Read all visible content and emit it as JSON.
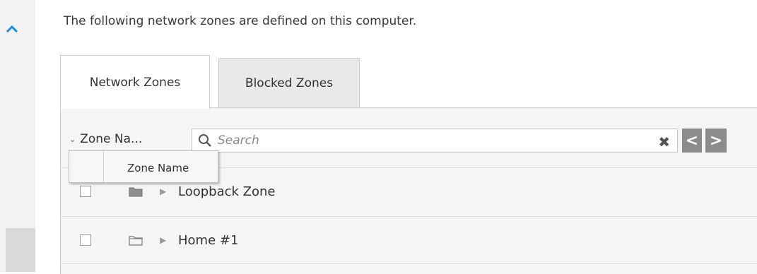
{
  "intro_text": "The following network zones are defined on this computer.",
  "tabs": [
    {
      "label": "Network Zones",
      "active": true
    },
    {
      "label": "Blocked Zones",
      "active": false
    }
  ],
  "toolbar": {
    "column_select_label": "Zone Na...",
    "search_placeholder": "Search",
    "clear_icon": "close-icon",
    "prev_label": "<",
    "next_label": ">"
  },
  "column_menu": {
    "items": [
      "Zone Name"
    ]
  },
  "rows": [
    {
      "label": "Loopback Zone",
      "checked": false
    },
    {
      "label": "Home #1",
      "checked": false
    }
  ],
  "colors": {
    "accent": "#1a8fd1",
    "nav_button": "#8c8c8c",
    "panel_bg": "#f5f5f5"
  }
}
